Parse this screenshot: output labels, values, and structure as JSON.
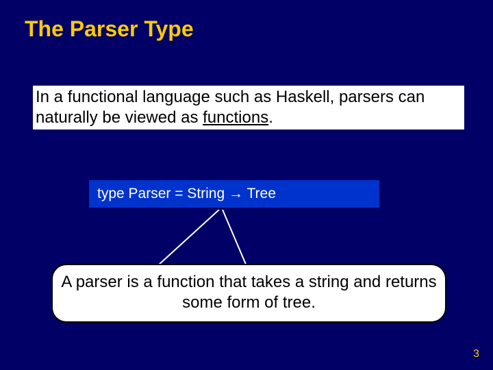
{
  "title": "The Parser Type",
  "body": {
    "pre": "In a functional language such as Haskell, parsers can naturally be viewed as ",
    "underlined": "functions",
    "post": "."
  },
  "code": {
    "pre": "type Parser = String ",
    "arrow": "→",
    "post": " Tree"
  },
  "callout": "A parser is a function that takes a string and returns some form of tree.",
  "pageNumber": "3"
}
